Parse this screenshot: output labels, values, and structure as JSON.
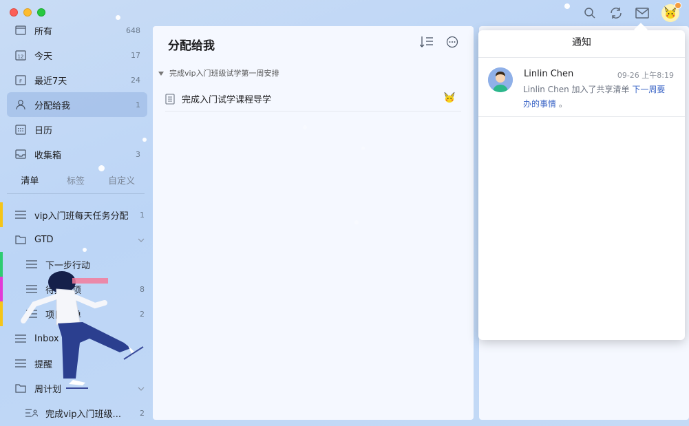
{
  "window": {
    "traffic_lights": [
      "close",
      "minimize",
      "zoom"
    ]
  },
  "toolbar": {
    "icons": [
      "search-icon",
      "sync-icon",
      "mail-icon",
      "user-avatar"
    ]
  },
  "sidebar": {
    "smart_lists": [
      {
        "label": "所有",
        "count": "648",
        "icon": "inbox-all-icon"
      },
      {
        "label": "今天",
        "count": "17",
        "icon": "calendar-today-icon"
      },
      {
        "label": "最近7天",
        "count": "24",
        "icon": "calendar-week-icon"
      },
      {
        "label": "分配给我",
        "count": "1",
        "icon": "assigned-user-icon",
        "active": true
      },
      {
        "label": "日历",
        "count": "",
        "icon": "calendar-grid-icon"
      },
      {
        "label": "收集箱",
        "count": "3",
        "icon": "inbox-tray-icon"
      }
    ],
    "tabs": [
      {
        "label": "清单",
        "active": true
      },
      {
        "label": "标签"
      },
      {
        "label": "自定义"
      }
    ],
    "lists": [
      {
        "label": "vip入门班每天任务分配",
        "count": "1",
        "icon": "list-icon",
        "color": "#f5c518"
      },
      {
        "label": "GTD",
        "count": "",
        "icon": "folder-icon",
        "expandable": true
      },
      {
        "label": "下一步行动",
        "count": "",
        "icon": "list-icon",
        "color": "#2ecc71",
        "child": true
      },
      {
        "label": "待办事项",
        "count": "8",
        "icon": "list-icon",
        "color": "#e23bd6",
        "child": true
      },
      {
        "label": "项目清单",
        "count": "2",
        "icon": "list-icon",
        "color": "#f5c518",
        "child": true
      },
      {
        "label": "Inbox",
        "count": "",
        "icon": "list-icon"
      },
      {
        "label": "提醒",
        "count": "",
        "icon": "list-icon"
      },
      {
        "label": "周计划",
        "count": "",
        "icon": "folder-icon",
        "expandable": true
      },
      {
        "label": "完成vip入门班级...",
        "count": "2",
        "icon": "shared-list-icon",
        "child": true
      }
    ]
  },
  "main": {
    "title": "分配给我",
    "group_header": "完成vip入门班级试学第一周安排",
    "tasks": [
      {
        "title": "完成入门试学课程导学",
        "assignee_icon": "pikachu-avatar-icon"
      }
    ]
  },
  "notification": {
    "title": "通知",
    "items": [
      {
        "name": "Linlin Chen",
        "time": "09-26 上午8:19",
        "text_prefix": "Linlin Chen 加入了共享清单",
        "link": "下一周要办的事情",
        "text_suffix": "。"
      }
    ]
  },
  "colors": {
    "accent": "#3a64c6",
    "background": "#c4daf6",
    "active_item": "#a7c0e6"
  }
}
